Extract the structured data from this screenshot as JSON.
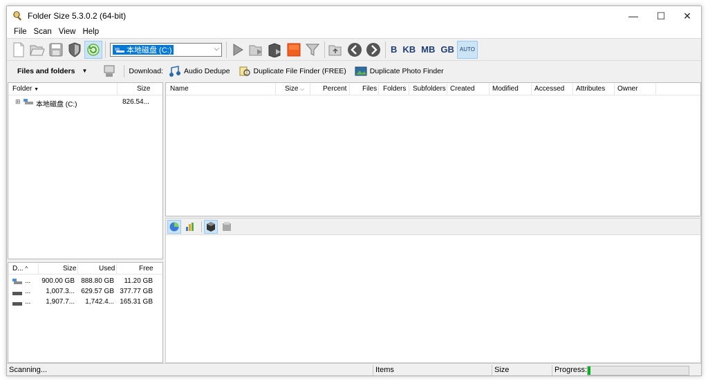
{
  "app": {
    "title": "Folder Size 5.3.0.2 (64-bit)",
    "controls": {
      "minimize": "—",
      "maximize": "☐",
      "close": "✕"
    }
  },
  "menu": [
    "File",
    "Scan",
    "View",
    "Help"
  ],
  "toolbar": {
    "drive_selected": "本地磁盘 (C:)",
    "units": [
      "B",
      "KB",
      "MB",
      "GB"
    ],
    "auto_label": "AUTO"
  },
  "toolbar2": {
    "view_mode": "Files and folders",
    "download_label": "Download:",
    "links": [
      "Audio Dedupe",
      "Duplicate File Finder (FREE)",
      "Duplicate Photo Finder"
    ]
  },
  "tree": {
    "columns": {
      "folder": "Folder",
      "size": "Size"
    },
    "rows": [
      {
        "expander": "⊞",
        "name": "本地磁盘 (C:)",
        "size": "826.54..."
      }
    ]
  },
  "list": {
    "columns": [
      "Name",
      "Size",
      "Percent",
      "Files",
      "Folders",
      "Subfolders",
      "Created",
      "Modified",
      "Accessed",
      "Attributes",
      "Owner"
    ]
  },
  "drives": {
    "columns": {
      "drive": "D...",
      "size": "Size",
      "used": "Used",
      "free": "Free"
    },
    "rows": [
      {
        "drive": "...",
        "size": "900.00 GB",
        "used": "888.80 GB",
        "free": "11.20 GB"
      },
      {
        "drive": "...",
        "size": "1,007.3...",
        "used": "629.57 GB",
        "free": "377.77 GB"
      },
      {
        "drive": "...",
        "size": "1,907.7...",
        "used": "1,742.4...",
        "free": "165.31 GB"
      }
    ]
  },
  "status": {
    "state": "Scanning...",
    "items_label": "Items",
    "size_label": "Size",
    "progress_label": "Progress:",
    "progress_value": 0.03
  },
  "colors": {
    "accent": "#0078d7",
    "progress": "#06b025",
    "unit_text": "#1f3d73"
  }
}
